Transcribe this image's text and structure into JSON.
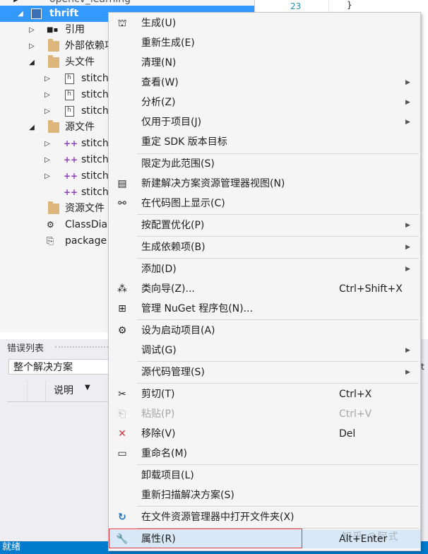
{
  "explorer": {
    "items": [
      {
        "label": "opencv_learning"
      },
      {
        "label": "thrift"
      },
      {
        "label": "引用"
      },
      {
        "label": "外部依赖项"
      },
      {
        "label": "头文件"
      },
      {
        "label": "stitch"
      },
      {
        "label": "stitch"
      },
      {
        "label": "stitch"
      },
      {
        "label": "源文件"
      },
      {
        "label": "stitch"
      },
      {
        "label": "stitch"
      },
      {
        "label": "stitch"
      },
      {
        "label": "stitch"
      },
      {
        "label": "资源文件"
      },
      {
        "label": "ClassDiag"
      },
      {
        "label": "package"
      }
    ]
  },
  "editor": {
    "line_number": "23",
    "brace": "}"
  },
  "error_list": {
    "title": "错误列表",
    "scope_value": "整个解决方案",
    "column_description": "说明",
    "right_fragment": "t"
  },
  "status_bar": {
    "text": "就绪"
  },
  "context_menu": {
    "items": [
      {
        "label": "生成(U)",
        "icon": "build-icon"
      },
      {
        "label": "重新生成(E)"
      },
      {
        "label": "清理(N)"
      },
      {
        "label": "查看(W)",
        "submenu": true
      },
      {
        "label": "分析(Z)",
        "submenu": true
      },
      {
        "label": "仅用于项目(J)",
        "submenu": true
      },
      {
        "label": "重定 SDK 版本目标"
      },
      {
        "label": "限定为此范围(S)"
      },
      {
        "label": "新建解决方案资源管理器视图(N)",
        "icon": "new-view-icon"
      },
      {
        "label": "在代码图上显示(C)",
        "icon": "code-map-icon"
      },
      {
        "label": "按配置优化(P)",
        "submenu": true
      },
      {
        "label": "生成依赖项(B)",
        "submenu": true
      },
      {
        "label": "添加(D)",
        "submenu": true
      },
      {
        "label": "类向导(Z)...",
        "shortcut": "Ctrl+Shift+X",
        "icon": "class-wizard-icon"
      },
      {
        "label": "管理 NuGet 程序包(N)...",
        "icon": "nuget-icon"
      },
      {
        "label": "设为启动项目(A)",
        "icon": "gear-icon"
      },
      {
        "label": "调试(G)",
        "submenu": true
      },
      {
        "label": "源代码管理(S)",
        "submenu": true
      },
      {
        "label": "剪切(T)",
        "shortcut": "Ctrl+X",
        "icon": "scissors-icon"
      },
      {
        "label": "粘贴(P)",
        "shortcut": "Ctrl+V",
        "icon": "paste-icon",
        "disabled": true
      },
      {
        "label": "移除(V)",
        "shortcut": "Del",
        "icon": "remove-icon"
      },
      {
        "label": "重命名(M)",
        "icon": "rename-icon"
      },
      {
        "label": "卸载项目(L)"
      },
      {
        "label": "重新扫描解决方案(S)"
      },
      {
        "label": "在文件资源管理器中打开文件夹(X)",
        "icon": "refresh-folder-icon"
      },
      {
        "label": "属性(R)",
        "shortcut": "Alt+Enter",
        "icon": "wrench-icon"
      }
    ]
  },
  "watermark": "知乎 @阿式",
  "colors": {
    "selection": "#3399ff",
    "status_bar": "#007acc",
    "highlight_box": "#e0373c"
  }
}
